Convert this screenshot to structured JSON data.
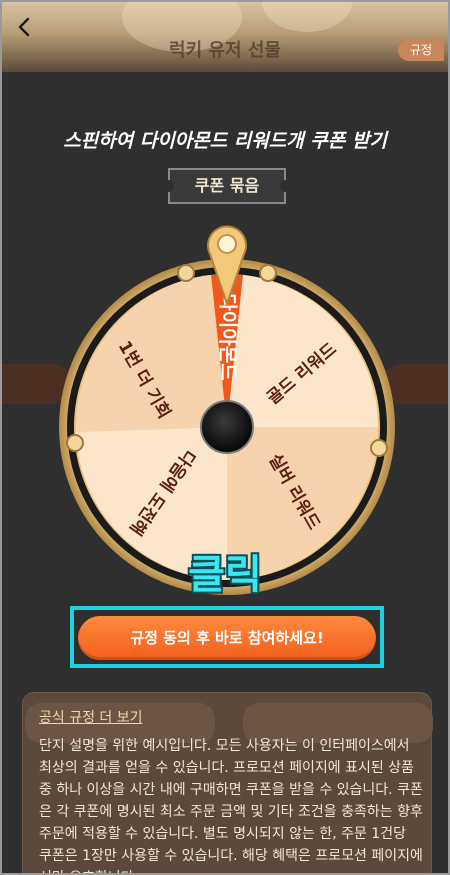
{
  "header": {
    "title": "럭키 유저 선물",
    "rules_label": "규정"
  },
  "headline": "스핀하여 다이아몬드 리워드개 쿠폰 받기",
  "coupon_tag": "쿠폰 묶음",
  "wheel": {
    "segments": [
      {
        "label": "다이아몬드"
      },
      {
        "label": "골드 리워드"
      },
      {
        "label": "실버 리워드"
      },
      {
        "label": "다음에 도전해"
      },
      {
        "label": "1번 더 기회"
      }
    ]
  },
  "click_label": "클릭",
  "cta_label": "규정 동의 후 바로 참여하세요!",
  "rules": {
    "link": "공식 규정 더 보기",
    "text": "단지 설명을 위한 예시입니다. 모든 사용자는 이 인터페이스에서 최상의 결과를 얻을 수 있습니다. 프로모션 페이지에 표시된 상품 중 하나 이상을 시간 내에 구매하면 쿠폰을 받을 수 있습니다. 쿠폰은 각 쿠폰에 명시된 최소 주문 금액 및 기타 조건을 충족하는 향후 주문에 적용할 수 있습니다. 별도 명시되지 않는 한, 주문 1건당 쿠폰은 1장만 사용할 수 있습니다. 해당 혜택은 프로모션 페이지에서만 유효합니다."
  },
  "colors": {
    "accent": "#f25f1c",
    "highlight": "#1fd0e0",
    "click_text": "#3ae6f2"
  }
}
